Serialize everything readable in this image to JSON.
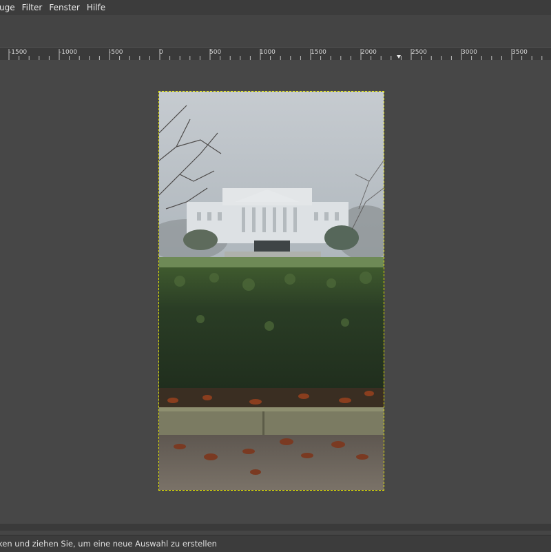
{
  "menubar": {
    "items": [
      "uge",
      "Filter",
      "Fenster",
      "Hilfe"
    ]
  },
  "ruler": {
    "labels": [
      "-1500",
      "-1000",
      "-500",
      "0",
      "500",
      "1000",
      "1500",
      "2000",
      "2500",
      "3000",
      "3500"
    ]
  },
  "statusbar": {
    "text": "ken und ziehen Sie, um eine neue Auswahl zu erstellen"
  },
  "colors": {
    "background": "#454545",
    "menubar": "#3c3c3c",
    "selection": "#e8e800"
  }
}
